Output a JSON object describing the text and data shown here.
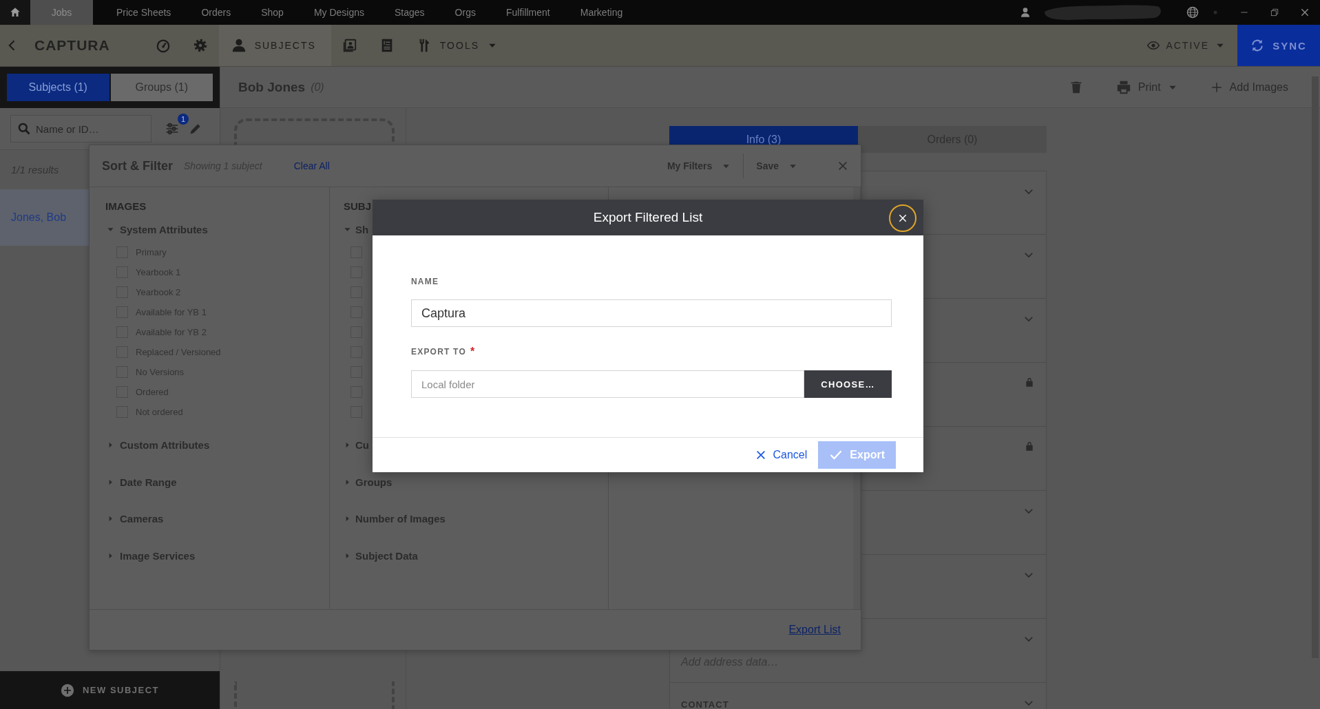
{
  "nav": {
    "tabs": [
      {
        "label": "Jobs",
        "selected": true
      },
      {
        "label": "Price Sheets",
        "selected": false
      },
      {
        "label": "Orders",
        "selected": false
      },
      {
        "label": "Shop",
        "selected": false
      },
      {
        "label": "My Designs",
        "selected": false
      },
      {
        "label": "Stages",
        "selected": false
      },
      {
        "label": "Orgs",
        "selected": false
      },
      {
        "label": "Fulfillment",
        "selected": false
      },
      {
        "label": "Marketing",
        "selected": false
      }
    ]
  },
  "toolbar": {
    "title": "CAPTURA",
    "tabs": [
      {
        "kind": "dashboard",
        "selected": false
      },
      {
        "kind": "settings",
        "selected": false
      },
      {
        "kind": "subjects",
        "label": "SUBJECTS",
        "selected": true
      },
      {
        "kind": "photos",
        "selected": false
      },
      {
        "kind": "invoice",
        "selected": false
      },
      {
        "kind": "tools",
        "label": "TOOLS",
        "selected": false
      }
    ],
    "status": "ACTIVE",
    "sync": "SYNC"
  },
  "sidebar": {
    "tabs": [
      {
        "label": "Subjects (1)",
        "selected": true
      },
      {
        "label": "Groups (1)",
        "selected": false
      }
    ],
    "search": {
      "placeholder": "Name or ID…"
    },
    "filter_badge": "1",
    "results": "1/1 results",
    "subjects": [
      {
        "name": "Jones, Bob",
        "selected": true
      }
    ],
    "new_button": "NEW SUBJECT"
  },
  "detail": {
    "name": "Bob Jones",
    "count": "(0)",
    "actions": [
      {
        "kind": "delete"
      },
      {
        "kind": "print",
        "label": "Print"
      },
      {
        "kind": "add",
        "label": "Add Images"
      }
    ],
    "tabs": [
      {
        "label": "Info (3)",
        "selected": true
      },
      {
        "label": "Orders (0)",
        "selected": false
      }
    ],
    "sections": [
      {
        "kind": "collapsible"
      },
      {
        "kind": "collapsible"
      },
      {
        "kind": "collapsible"
      },
      {
        "kind": "locked"
      },
      {
        "kind": "locked"
      },
      {
        "kind": "collapsible"
      },
      {
        "kind": "collapsible"
      },
      {
        "kind": "collapsible",
        "placeholder": "Add address data…"
      },
      {
        "kind": "collapsible",
        "title": "CONTACT"
      }
    ]
  },
  "filter_panel": {
    "title": "Sort & Filter",
    "summary": "Showing 1 subject",
    "clear": "Clear All",
    "menus": [
      "My Filters",
      "Save"
    ],
    "columns": [
      {
        "heading": "IMAGES",
        "groups": [
          {
            "label": "System Attributes",
            "expanded": true,
            "options": [
              {
                "label": "Primary",
                "checked": false
              },
              {
                "label": "Yearbook 1",
                "checked": false
              },
              {
                "label": "Yearbook 2",
                "checked": false
              },
              {
                "label": "Available for YB 1",
                "checked": false
              },
              {
                "label": "Available for YB 2",
                "checked": false
              },
              {
                "label": "Replaced / Versioned",
                "checked": false
              },
              {
                "label": "No Versions",
                "checked": false
              },
              {
                "label": "Ordered",
                "checked": false
              },
              {
                "label": "Not ordered",
                "checked": false
              }
            ]
          },
          {
            "label": "Custom Attributes",
            "expanded": false
          },
          {
            "label": "Date Range",
            "expanded": false
          },
          {
            "label": "Cameras",
            "expanded": false
          },
          {
            "label": "Image Services",
            "expanded": false
          }
        ]
      },
      {
        "heading": "SUBJ",
        "groups": [
          {
            "label": "Sh",
            "expanded": true,
            "options": [
              {
                "checked": false
              },
              {
                "checked": false
              },
              {
                "checked": false
              },
              {
                "checked": false
              },
              {
                "checked": false
              },
              {
                "checked": false
              },
              {
                "checked": false
              },
              {
                "checked": false
              },
              {
                "checked": false
              }
            ]
          },
          {
            "label": "Cu",
            "expanded": false
          },
          {
            "label": "Groups",
            "expanded": false
          },
          {
            "label": "Number of Images",
            "expanded": false
          },
          {
            "label": "Subject Data",
            "expanded": false
          }
        ]
      }
    ],
    "footer_link": "Export List"
  },
  "dialog": {
    "title": "Export Filtered List",
    "fields": [
      {
        "label": "NAME",
        "value": "Captura"
      },
      {
        "label": "EXPORT TO",
        "required_mark": "*",
        "placeholder": "Local folder",
        "button": "CHOOSE…"
      }
    ],
    "cancel": "Cancel",
    "confirm": {
      "label": "Export",
      "disabled": true
    }
  }
}
